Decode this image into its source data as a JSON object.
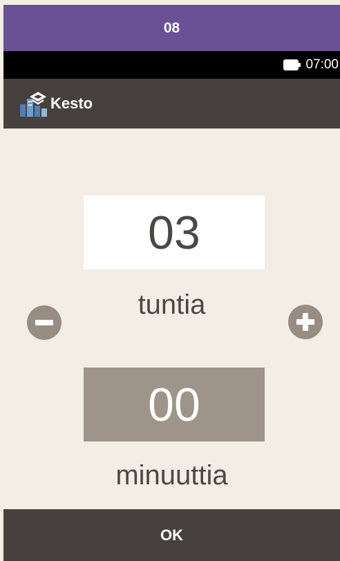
{
  "banner": {
    "text": "08",
    "color": "#6a5094"
  },
  "status": {
    "time": "07:00",
    "battery_icon": "battery-full-icon"
  },
  "header": {
    "title": "Kesto",
    "icon": "duration-settings-icon"
  },
  "duration": {
    "hours_value": "03",
    "hours_label": "tuntia",
    "minutes_value": "00",
    "minutes_label": "minuuttia",
    "selected_field": "hours"
  },
  "controls": {
    "decrement_icon": "minus-circle-icon",
    "increment_icon": "plus-circle-icon"
  },
  "footer": {
    "ok_label": "OK"
  },
  "colors": {
    "background": "#f2eee5",
    "dark_bar": "#46413e",
    "inactive_field": "#9e948a",
    "button": "#988d83",
    "text": "#4b4744"
  }
}
